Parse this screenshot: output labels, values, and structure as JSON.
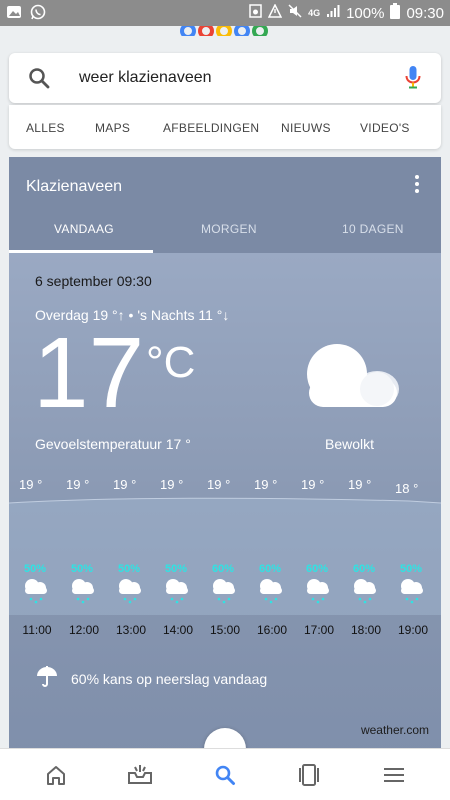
{
  "status": {
    "battery": "100%",
    "time": "09:30",
    "network": "4G",
    "icons": [
      "image-icon",
      "whatsapp-icon",
      "photo-icon",
      "alert-icon",
      "mute-icon",
      "signal-icon",
      "battery-icon"
    ]
  },
  "search": {
    "query": "weer klazienaveen"
  },
  "tabs": [
    "ALLES",
    "MAPS",
    "AFBEELDINGEN",
    "NIEUWS",
    "VIDEO'S"
  ],
  "weather": {
    "location": "Klazienaveen",
    "day_tabs": [
      "VANDAAG",
      "MORGEN",
      "10 DAGEN"
    ],
    "date_time": "6 september 09:30",
    "high_low": "Overdag 19 °↑ • 's Nachts 11 °↓",
    "temperature": "17",
    "unit": "°C",
    "feels_like": "Gevoelstemperatuur 17 °",
    "condition": "Bewolkt",
    "hourly": [
      {
        "time": "11:00",
        "temp": "19 °",
        "precip": "50%"
      },
      {
        "time": "12:00",
        "temp": "19 °",
        "precip": "50%"
      },
      {
        "time": "13:00",
        "temp": "19 °",
        "precip": "50%"
      },
      {
        "time": "14:00",
        "temp": "19 °",
        "precip": "50%"
      },
      {
        "time": "15:00",
        "temp": "19 °",
        "precip": "60%"
      },
      {
        "time": "16:00",
        "temp": "19 °",
        "precip": "60%"
      },
      {
        "time": "17:00",
        "temp": "19 °",
        "precip": "60%"
      },
      {
        "time": "18:00",
        "temp": "19 °",
        "precip": "60%"
      },
      {
        "time": "19:00",
        "temp": "18 °",
        "precip": "50%"
      }
    ],
    "precip_summary": "60% kans op neerslag vandaag",
    "source": "weather.com"
  },
  "colors": {
    "card_header": "#7b8aa5",
    "card_body": "#8a9ab3",
    "precip_accent": "#2fe3e3",
    "nav_active": "#4285f4"
  },
  "bottom_nav": [
    "home-icon",
    "inbox-icon",
    "search-icon",
    "tabs-icon",
    "menu-icon"
  ]
}
